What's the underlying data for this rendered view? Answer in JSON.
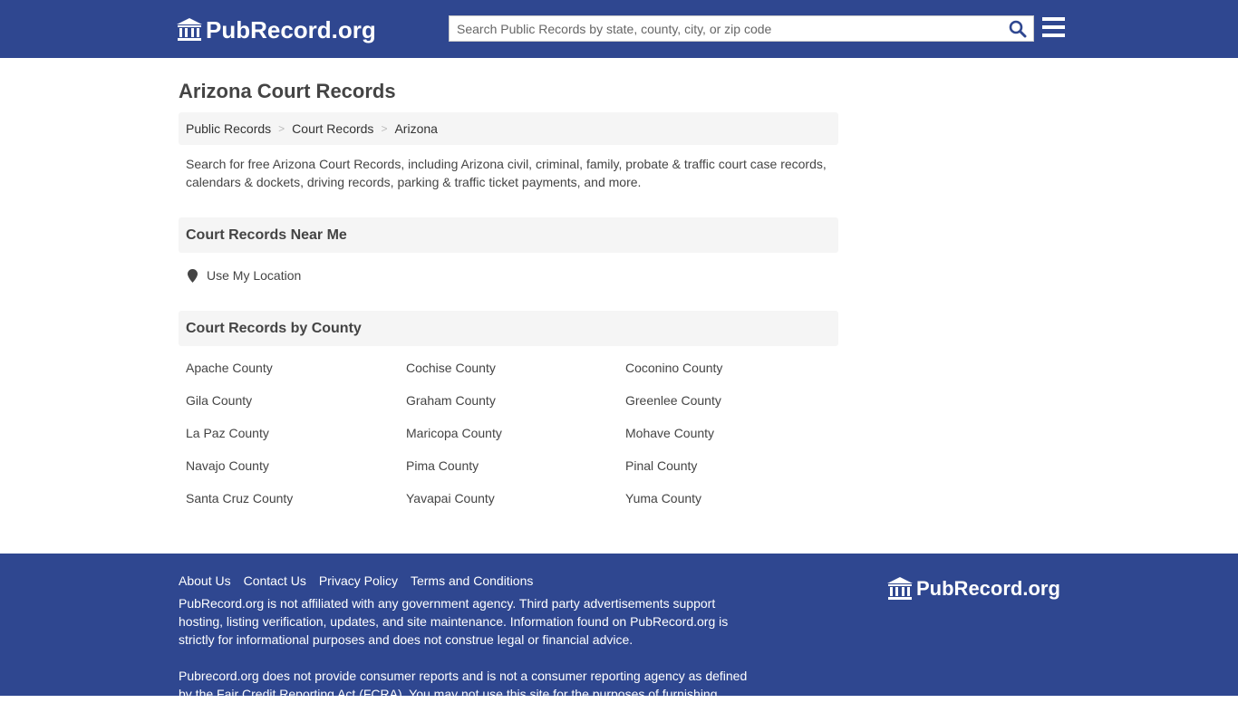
{
  "header": {
    "logo_text": "PubRecord.org",
    "search_placeholder": "Search Public Records by state, county, city, or zip code"
  },
  "page": {
    "title": "Arizona Court Records",
    "breadcrumb": [
      "Public Records",
      "Court Records",
      "Arizona"
    ],
    "intro": "Search for free Arizona Court Records, including Arizona civil, criminal, family, probate & traffic court case records, calendars & dockets, driving records, parking & traffic ticket payments, and more."
  },
  "near_me": {
    "heading": "Court Records Near Me",
    "location_label": "Use My Location"
  },
  "by_county": {
    "heading": "Court Records by County",
    "counties": [
      "Apache County",
      "Cochise County",
      "Coconino County",
      "Gila County",
      "Graham County",
      "Greenlee County",
      "La Paz County",
      "Maricopa County",
      "Mohave County",
      "Navajo County",
      "Pima County",
      "Pinal County",
      "Santa Cruz County",
      "Yavapai County",
      "Yuma County"
    ]
  },
  "footer": {
    "links": [
      "About Us",
      "Contact Us",
      "Privacy Policy",
      "Terms and Conditions"
    ],
    "disclaimer_1": "PubRecord.org is not affiliated with any government agency. Third party advertisements support hosting, listing verification, updates, and site maintenance. Information found on PubRecord.org is strictly for informational purposes and does not construe legal or financial advice.",
    "disclaimer_2": "Pubrecord.org does not provide consumer reports and is not a consumer reporting agency as defined by the Fair Credit Reporting Act (FCRA). You may not use this site for the purposes of furnishing",
    "logo_text": "PubRecord.org"
  },
  "colors": {
    "brand": "#2f4790",
    "search_icon": "#2f4790"
  }
}
